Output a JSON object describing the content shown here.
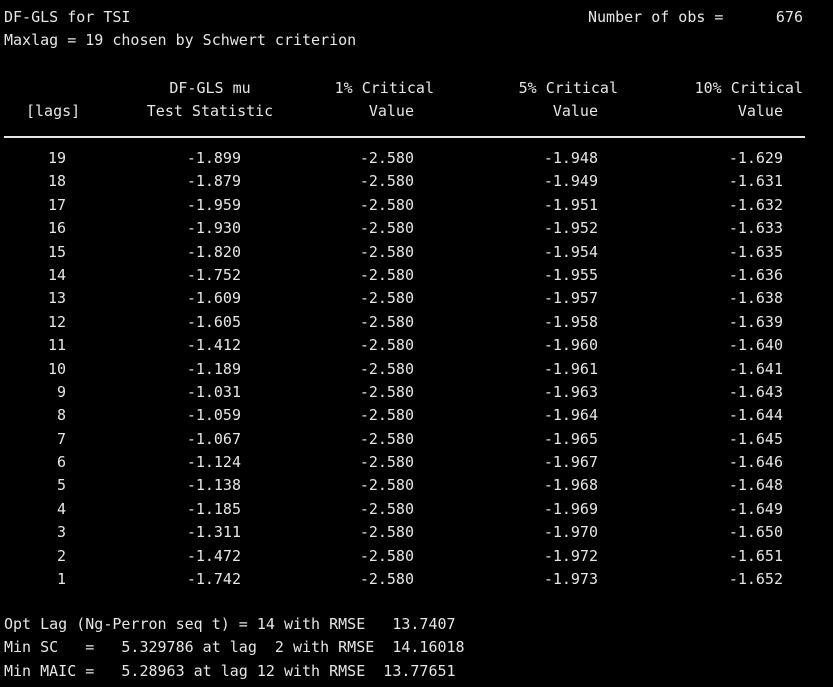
{
  "header": {
    "title": "DF-GLS for TSI",
    "obs_label": "Number of obs =",
    "obs_value": "676",
    "maxlag_line": "Maxlag = 19 chosen by Schwert criterion"
  },
  "columns": {
    "head1": [
      "",
      "DF-GLS mu",
      "1% Critical",
      "5% Critical",
      "10% Critical"
    ],
    "head2": [
      "[lags]",
      "Test Statistic",
      "Value",
      "Value",
      "Value"
    ]
  },
  "rows": [
    [
      "19",
      "-1.899",
      "-2.580",
      "-1.948",
      "-1.629"
    ],
    [
      "18",
      "-1.879",
      "-2.580",
      "-1.949",
      "-1.631"
    ],
    [
      "17",
      "-1.959",
      "-2.580",
      "-1.951",
      "-1.632"
    ],
    [
      "16",
      "-1.930",
      "-2.580",
      "-1.952",
      "-1.633"
    ],
    [
      "15",
      "-1.820",
      "-2.580",
      "-1.954",
      "-1.635"
    ],
    [
      "14",
      "-1.752",
      "-2.580",
      "-1.955",
      "-1.636"
    ],
    [
      "13",
      "-1.609",
      "-2.580",
      "-1.957",
      "-1.638"
    ],
    [
      "12",
      "-1.605",
      "-2.580",
      "-1.958",
      "-1.639"
    ],
    [
      "11",
      "-1.412",
      "-2.580",
      "-1.960",
      "-1.640"
    ],
    [
      "10",
      "-1.189",
      "-2.580",
      "-1.961",
      "-1.641"
    ],
    [
      "9",
      "-1.031",
      "-2.580",
      "-1.963",
      "-1.643"
    ],
    [
      "8",
      "-1.059",
      "-2.580",
      "-1.964",
      "-1.644"
    ],
    [
      "7",
      "-1.067",
      "-2.580",
      "-1.965",
      "-1.645"
    ],
    [
      "6",
      "-1.124",
      "-2.580",
      "-1.967",
      "-1.646"
    ],
    [
      "5",
      "-1.138",
      "-2.580",
      "-1.968",
      "-1.648"
    ],
    [
      "4",
      "-1.185",
      "-2.580",
      "-1.969",
      "-1.649"
    ],
    [
      "3",
      "-1.311",
      "-2.580",
      "-1.970",
      "-1.650"
    ],
    [
      "2",
      "-1.472",
      "-2.580",
      "-1.972",
      "-1.651"
    ],
    [
      "1",
      "-1.742",
      "-2.580",
      "-1.973",
      "-1.652"
    ]
  ],
  "footer": {
    "opt_lag": "Opt Lag (Ng-Perron seq t) = 14 with RMSE   13.7407",
    "min_sc": "Min SC   =   5.329786 at lag  2 with RMSE  14.16018",
    "min_maic": "Min MAIC =   5.28963 at lag 12 with RMSE  13.77651"
  },
  "colors": {
    "background": "#000000",
    "text": "#e6e6e6"
  }
}
